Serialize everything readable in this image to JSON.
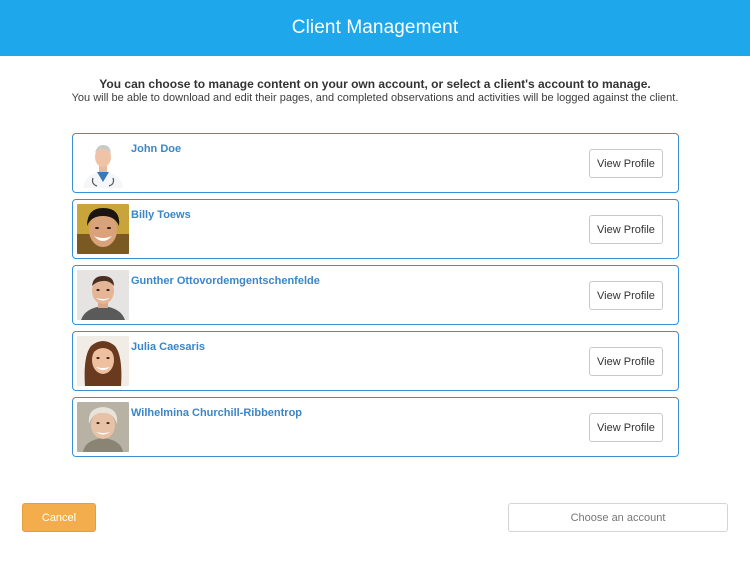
{
  "header": {
    "title": "Client Management",
    "background_color": "#1ea7ea"
  },
  "intro": {
    "line1": "You can choose to manage content on your own account, or select a client's account to manage.",
    "line2": "You will be able to download and edit their pages, and completed observations and activities will be logged against the client."
  },
  "clients": [
    {
      "name": "John Doe",
      "view_label": "View Profile",
      "avatar_icon": "doctor-avatar-icon"
    },
    {
      "name": "Billy Toews",
      "view_label": "View Profile",
      "avatar_icon": "smiling-man-avatar-icon"
    },
    {
      "name": "Gunther Ottovordemgentschenfelde",
      "view_label": "View Profile",
      "avatar_icon": "man-avatar-icon"
    },
    {
      "name": "Julia Caesaris",
      "view_label": "View Profile",
      "avatar_icon": "woman-avatar-icon"
    },
    {
      "name": "Wilhelmina Churchill-Ribbentrop",
      "view_label": "View Profile",
      "avatar_icon": "elderly-woman-avatar-icon"
    }
  ],
  "footer": {
    "cancel_label": "Cancel",
    "choose_label": "Choose an account",
    "cancel_color": "#f3ad4c"
  },
  "colors": {
    "accent": "#1ea7ea",
    "name_text": "#3a86c8",
    "card_border": "#3a8fd6"
  }
}
